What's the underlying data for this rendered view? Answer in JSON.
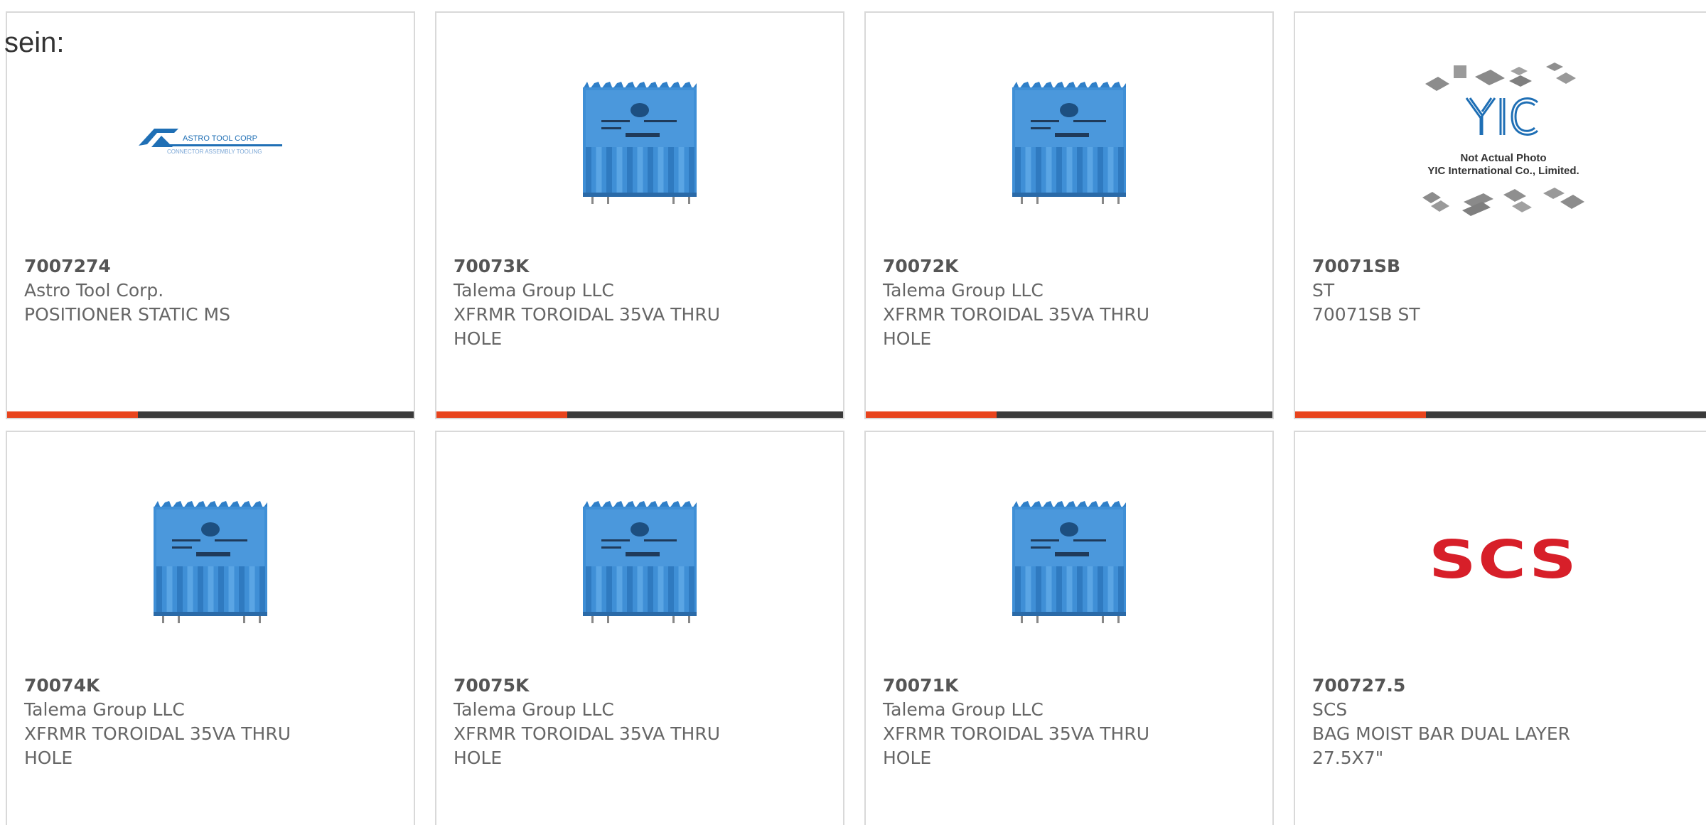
{
  "heading_fragment": "sein:",
  "colors": {
    "accent_bar": "#e8441d",
    "dark_bar": "#3a3a3a",
    "card_border": "#d9d9d9",
    "transformer_blue": "#3f8fd6",
    "scs_red": "#d71f29",
    "astro_blue": "#1f6fb5"
  },
  "products": [
    {
      "part_number": "7007274",
      "manufacturer": "Astro Tool Corp.",
      "description": "POSITIONER STATIC MS",
      "image_type": "astro-logo",
      "logo_title": "ASTRO TOOL CORP",
      "logo_subtitle": "CONNECTOR ASSEMBLY TOOLING"
    },
    {
      "part_number": "70073K",
      "manufacturer": "Talema Group LLC",
      "description": "XFRMR TOROIDAL 35VA THRU HOLE",
      "image_type": "transformer"
    },
    {
      "part_number": "70072K",
      "manufacturer": "Talema Group LLC",
      "description": "XFRMR TOROIDAL 35VA THRU HOLE",
      "image_type": "transformer"
    },
    {
      "part_number": "70071SB",
      "manufacturer": "ST",
      "description": "70071SB ST",
      "image_type": "yic-placeholder",
      "placeholder_logo": "YIC",
      "placeholder_line1": "Not Actual Photo",
      "placeholder_line2": "YIC International Co., Limited."
    },
    {
      "part_number": "70074K",
      "manufacturer": "Talema Group LLC",
      "description": "XFRMR TOROIDAL 35VA THRU HOLE",
      "image_type": "transformer"
    },
    {
      "part_number": "70075K",
      "manufacturer": "Talema Group LLC",
      "description": "XFRMR TOROIDAL 35VA THRU HOLE",
      "image_type": "transformer"
    },
    {
      "part_number": "70071K",
      "manufacturer": "Talema Group LLC",
      "description": "XFRMR TOROIDAL 35VA THRU HOLE",
      "image_type": "transformer"
    },
    {
      "part_number": "700727.5",
      "manufacturer": "SCS",
      "description": "BAG MOIST BAR DUAL LAYER 27.5X7\"",
      "image_type": "scs-logo",
      "logo_text": "SCS"
    }
  ]
}
